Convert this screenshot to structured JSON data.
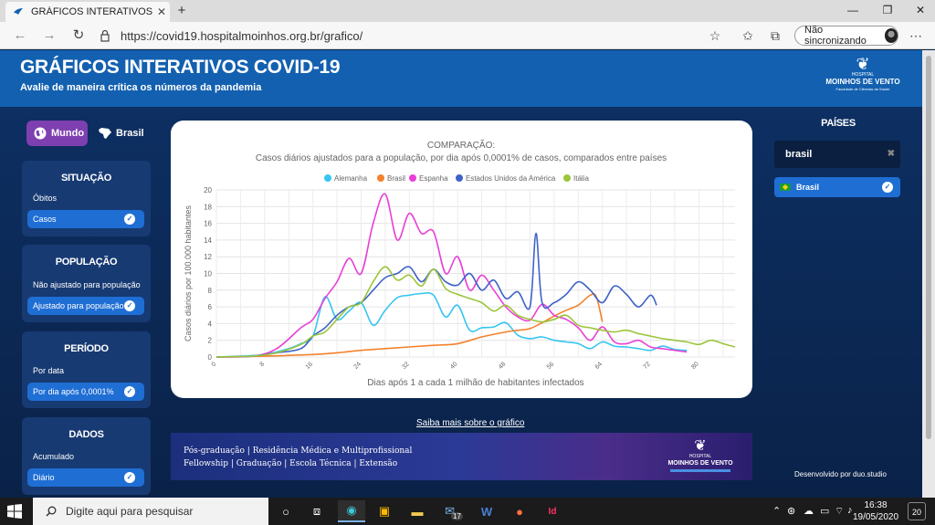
{
  "browser": {
    "tab_title": "GRÁFICOS INTERATIVOS COVID-",
    "url": "https://covid19.hospitalmoinhos.org.br/grafico/",
    "sync_label": "Não sincronizando"
  },
  "header": {
    "title": "GRÁFICOS INTERATIVOS COVID-19",
    "subtitle": "Avalie de maneira crítica os números da pandemia",
    "logo_small": "HOSPITAL",
    "logo_name": "MOINHOS DE VENTO",
    "logo_faculty": "Faculdade de Ciências da Saúde"
  },
  "scope_toggle": {
    "mundo": "Mundo",
    "brasil": "Brasil"
  },
  "panels": {
    "situacao": {
      "title": "SITUAÇÃO",
      "label": "Óbitos",
      "selected": "Casos"
    },
    "populacao": {
      "title": "POPULAÇÃO",
      "label": "Não ajustado para população",
      "selected": "Ajustado para população"
    },
    "periodo": {
      "title": "PERÍODO",
      "label": "Por data",
      "selected": "Por dia após 0,0001%"
    },
    "dados": {
      "title": "DADOS",
      "label": "Acumulado",
      "selected": "Diário"
    }
  },
  "chart_data": {
    "type": "line",
    "title": "COMPARAÇÃO:",
    "subtitle": "Casos diários ajustados para a população, por dia após 0,0001% de casos, comparados entre países",
    "xlabel": "Dias após 1 a cada 1 milhão de habitantes infectados",
    "ylabel": "Casos diários por 100.000 habitantes",
    "xlim": [
      0,
      86
    ],
    "ylim": [
      0,
      20
    ],
    "x_ticks": [
      0,
      8,
      16,
      24,
      32,
      40,
      48,
      56,
      64,
      72,
      80
    ],
    "y_ticks": [
      0,
      2,
      4,
      6,
      8,
      10,
      12,
      14,
      16,
      18,
      20
    ],
    "grid": true,
    "legend": "top",
    "series": [
      {
        "name": "Alemanha",
        "color": "#36c5f0",
        "x": [
          0,
          4,
          8,
          12,
          14,
          16,
          18,
          20,
          22,
          24,
          26,
          28,
          30,
          32,
          34,
          36,
          38,
          40,
          42,
          44,
          46,
          48,
          50,
          52,
          54,
          56,
          58,
          60,
          62,
          64,
          66,
          68,
          70,
          72,
          74,
          76,
          78
        ],
        "y": [
          0,
          0.1,
          0.3,
          1,
          1.6,
          2.5,
          7.2,
          4.5,
          5.5,
          6.5,
          3.8,
          5.6,
          7.1,
          7.4,
          7.6,
          7.4,
          4.8,
          6.2,
          3.2,
          3.5,
          3.6,
          4.1,
          2.6,
          2.2,
          2.4,
          2.0,
          1.8,
          1.6,
          1.0,
          1.8,
          1.3,
          1.2,
          1.0,
          0.8,
          1.3,
          0.9,
          0.8
        ]
      },
      {
        "name": "Brasil",
        "color": "#f4812c",
        "x": [
          0,
          8,
          16,
          20,
          24,
          28,
          32,
          36,
          40,
          44,
          48,
          50,
          52,
          54,
          56,
          58,
          60,
          62,
          63,
          64
        ],
        "y": [
          0,
          0.1,
          0.3,
          0.5,
          0.8,
          1.0,
          1.2,
          1.4,
          1.6,
          2.4,
          3.0,
          3.2,
          3.4,
          4.1,
          4.9,
          5.6,
          6.2,
          7.4,
          7.2,
          4.2
        ]
      },
      {
        "name": "Espanha",
        "color": "#e93fd6",
        "x": [
          0,
          6,
          10,
          14,
          16,
          18,
          20,
          22,
          24,
          26,
          28,
          30,
          32,
          34,
          36,
          38,
          40,
          42,
          44,
          46,
          48,
          50,
          52,
          54,
          56,
          58,
          60,
          62,
          64,
          66,
          68,
          70,
          72,
          74,
          76,
          78
        ],
        "y": [
          0,
          0.1,
          1.0,
          3.5,
          4.5,
          7.0,
          9.0,
          11.8,
          10.0,
          16.0,
          19.5,
          14.0,
          17.2,
          14.8,
          15.0,
          10.0,
          12.0,
          8.0,
          9.8,
          8.0,
          6.0,
          4.8,
          4.4,
          6.3,
          5.0,
          4.5,
          3.5,
          2.0,
          3.6,
          1.8,
          1.6,
          2.0,
          1.2,
          1.0,
          0.8,
          0.6
        ]
      },
      {
        "name": "Estados Unidos da América",
        "color": "#3d63c8",
        "x": [
          0,
          6,
          10,
          14,
          16,
          18,
          20,
          22,
          24,
          26,
          28,
          30,
          32,
          34,
          36,
          38,
          40,
          42,
          44,
          46,
          48,
          50,
          52,
          53,
          54,
          56,
          58,
          60,
          62,
          64,
          66,
          68,
          70,
          72,
          73
        ],
        "y": [
          0,
          0.1,
          0.5,
          1.0,
          2.5,
          3.5,
          5.0,
          6.0,
          6.5,
          8.0,
          9.5,
          10.0,
          10.8,
          9.0,
          10.5,
          9.0,
          8.6,
          10.0,
          8.0,
          9.2,
          7.0,
          7.8,
          6.0,
          14.8,
          6.5,
          6.5,
          7.5,
          9.0,
          8.0,
          6.5,
          8.5,
          7.5,
          6.0,
          7.4,
          6.2
        ]
      },
      {
        "name": "Itália",
        "color": "#9cc53b",
        "x": [
          0,
          6,
          10,
          14,
          16,
          18,
          20,
          22,
          24,
          26,
          28,
          30,
          32,
          34,
          36,
          38,
          40,
          42,
          44,
          46,
          48,
          50,
          52,
          54,
          56,
          58,
          60,
          62,
          64,
          66,
          68,
          70,
          72,
          74,
          76,
          78,
          80,
          82,
          84,
          86
        ],
        "y": [
          0,
          0.1,
          0.5,
          1.5,
          2.5,
          3.0,
          4.5,
          6.0,
          6.5,
          9.0,
          10.8,
          9.2,
          9.8,
          8.5,
          10.5,
          8.2,
          7.5,
          7.0,
          6.5,
          5.5,
          6.2,
          5.0,
          4.5,
          4.2,
          4.5,
          5.0,
          3.8,
          3.5,
          3.2,
          3.0,
          3.2,
          2.8,
          2.5,
          2.2,
          2.0,
          1.8,
          1.5,
          2.0,
          1.6,
          1.2
        ]
      }
    ]
  },
  "more_link": "Saiba mais sobre o gráfico",
  "banner": {
    "line1": "Pós-graduação  |  Residência Médica e Multiprofissional",
    "line2": "Fellowship  |  Graduação  |  Escola Técnica  |  Extensão",
    "logo_small": "HOSPITAL",
    "logo_name": "MOINHOS DE VENTO"
  },
  "countries": {
    "title": "PAÍSES",
    "search_value": "brasil",
    "selected": "Brasil"
  },
  "footer_credit": "Desenvolvido por duo.studio",
  "taskbar": {
    "search_placeholder": "Digite aqui para pesquisar",
    "time": "16:38",
    "date": "19/05/2020",
    "notif_count": "20",
    "mail_badge": "17"
  }
}
